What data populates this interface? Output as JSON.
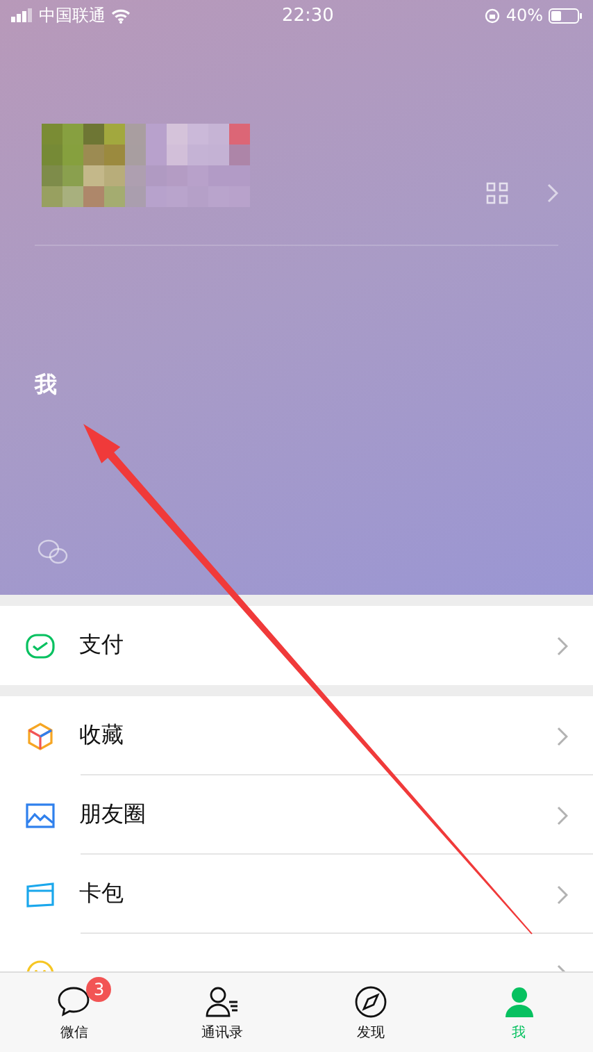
{
  "status_bar": {
    "carrier": "中国联通",
    "time": "22:30",
    "battery": "40%"
  },
  "profile": {
    "title": "我"
  },
  "menu_groups": [
    [
      {
        "kind": "pay",
        "label": "支付"
      }
    ],
    [
      {
        "kind": "favorites",
        "label": "收藏"
      },
      {
        "kind": "moments",
        "label": "朋友圈"
      },
      {
        "kind": "cards",
        "label": "卡包"
      },
      {
        "kind": "stickers"
      }
    ]
  ],
  "tabs": [
    {
      "kind": "chats",
      "label": "微信",
      "selected": false,
      "badge": "3"
    },
    {
      "kind": "contacts",
      "label": "通讯录",
      "selected": false
    },
    {
      "kind": "discover",
      "label": "发现",
      "selected": false
    },
    {
      "kind": "me",
      "label": "我",
      "selected": true
    }
  ]
}
